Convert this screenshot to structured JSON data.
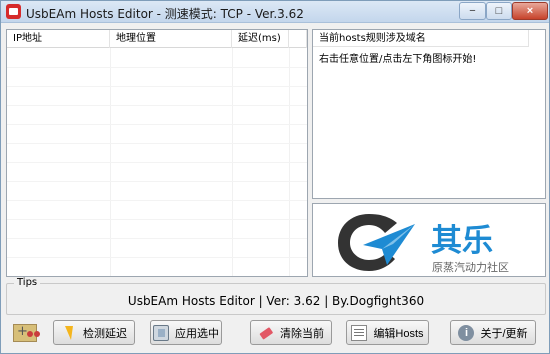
{
  "window": {
    "title": "UsbEAm Hosts Editor - 测速模式: TCP - Ver.3.62",
    "min_icon": "−",
    "max_icon": "□",
    "close_icon": "×"
  },
  "left_list": {
    "headers": [
      "IP地址",
      "地理位置",
      "延迟(ms)",
      ""
    ],
    "rows": []
  },
  "right_panel": {
    "header": "当前hosts规则涉及域名",
    "message": "右击任意位置/点击左下角图标开始!"
  },
  "logo": {
    "main_text": "其乐",
    "sub_text": "原蒸汽动力社区",
    "colors": {
      "ring": "#333333",
      "arrow": "#1e8bd3",
      "text": "#1e8bd3"
    }
  },
  "tips": {
    "label": "Tips",
    "text": "UsbEAm Hosts Editor | Ver: 3.62 | By.Dogfight360"
  },
  "buttons": [
    {
      "id": "detect",
      "label": "检测延迟",
      "icon": "bolt-icon"
    },
    {
      "id": "apply",
      "label": "应用选中",
      "icon": "apply-icon"
    },
    {
      "id": "clear",
      "label": "清除当前",
      "icon": "eraser-icon"
    },
    {
      "id": "edit",
      "label": "编辑Hosts",
      "icon": "edit-icon"
    },
    {
      "id": "about",
      "label": "关于/更新",
      "icon": "info-icon"
    }
  ],
  "bottom_left_icon": "start-tool-icon"
}
